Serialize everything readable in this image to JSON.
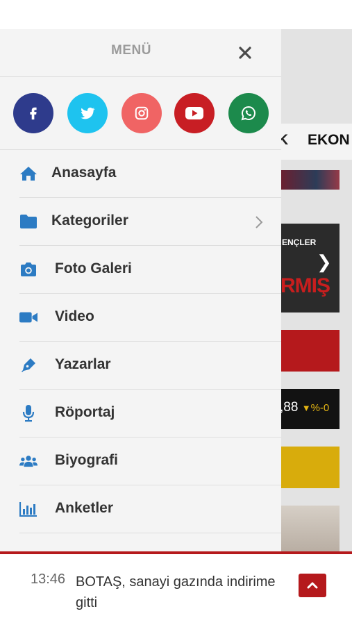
{
  "background": {
    "nav_partial_1": "K",
    "nav_partial_2": "EKON",
    "headline_partial_1": "ENÇLER",
    "headline_partial_2": "RMIŞ",
    "market_value": ",88",
    "market_change": "%-0"
  },
  "drawer": {
    "title": "MENÜ",
    "close_icon": "close-icon",
    "socials": [
      {
        "name": "facebook",
        "color": "#2e3b8c"
      },
      {
        "name": "twitter",
        "color": "#1ec3ef"
      },
      {
        "name": "instagram",
        "color": "#f06464"
      },
      {
        "name": "youtube",
        "color": "#c81e24"
      },
      {
        "name": "whatsapp",
        "color": "#1c8a4c"
      }
    ],
    "items": [
      {
        "label": "Anasayfa",
        "icon": "home-icon"
      },
      {
        "label": "Kategoriler",
        "icon": "folder-icon",
        "has_submenu": true
      },
      {
        "label": "Foto Galeri",
        "icon": "camera-icon"
      },
      {
        "label": "Video",
        "icon": "video-camera-icon"
      },
      {
        "label": "Yazarlar",
        "icon": "pen-icon"
      },
      {
        "label": "Röportaj",
        "icon": "microphone-icon"
      },
      {
        "label": "Biyografi",
        "icon": "users-icon"
      },
      {
        "label": "Anketler",
        "icon": "bar-chart-icon"
      }
    ]
  },
  "ticker": {
    "time": "13:46",
    "headline": "BOTAŞ, sanayi gazında indirime gitti"
  },
  "colors": {
    "accent_blue": "#2c7bc3",
    "brand_red": "#b5191c",
    "drawer_bg": "#f4f4f4"
  }
}
